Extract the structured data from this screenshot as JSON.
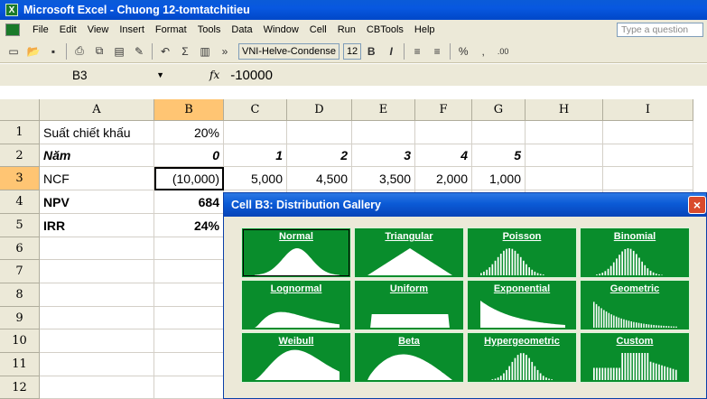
{
  "window": {
    "title": "Microsoft Excel - Chuong 12-tomtatchitieu"
  },
  "menu": {
    "items": [
      "File",
      "Edit",
      "View",
      "Insert",
      "Format",
      "Tools",
      "Data",
      "Window",
      "Cell",
      "Run",
      "CBTools",
      "Help"
    ],
    "search_placeholder": "Type a question"
  },
  "toolbar": {
    "font_name": "VNI-Helve-Condense",
    "font_size": "12",
    "sigma": "Σ",
    "bold": "B",
    "italic": "I",
    "percent": "%",
    "comma": ",",
    "decimal": ".00"
  },
  "formula_bar": {
    "cell_ref": "B3",
    "fx": "fx",
    "value": "-10000"
  },
  "columns": [
    "A",
    "B",
    "C",
    "D",
    "E",
    "F",
    "G",
    "H",
    "I"
  ],
  "rows": [
    "1",
    "2",
    "3",
    "4",
    "5",
    "6",
    "7",
    "8",
    "9",
    "10",
    "11",
    "12"
  ],
  "cells": {
    "A1": "Suất chiết khấu",
    "B1": "20%",
    "A2": "Năm",
    "B2": "0",
    "C2": "1",
    "D2": "2",
    "E2": "3",
    "F2": "4",
    "G2": "5",
    "A3": "NCF",
    "B3": "(10,000)",
    "C3": "5,000",
    "D3": "4,500",
    "E3": "3,500",
    "F3": "2,000",
    "G3": "1,000",
    "A4": "NPV",
    "B4": "684",
    "A5": "IRR",
    "B5": "24%"
  },
  "dialog": {
    "title": "Cell B3: Distribution Gallery",
    "close": "×",
    "selected": "Normal",
    "distributions": [
      "Normal",
      "Triangular",
      "Poisson",
      "Binomial",
      "Lognormal",
      "Uniform",
      "Exponential",
      "Geometric",
      "Weibull",
      "Beta",
      "Hypergeometric",
      "Custom"
    ]
  }
}
